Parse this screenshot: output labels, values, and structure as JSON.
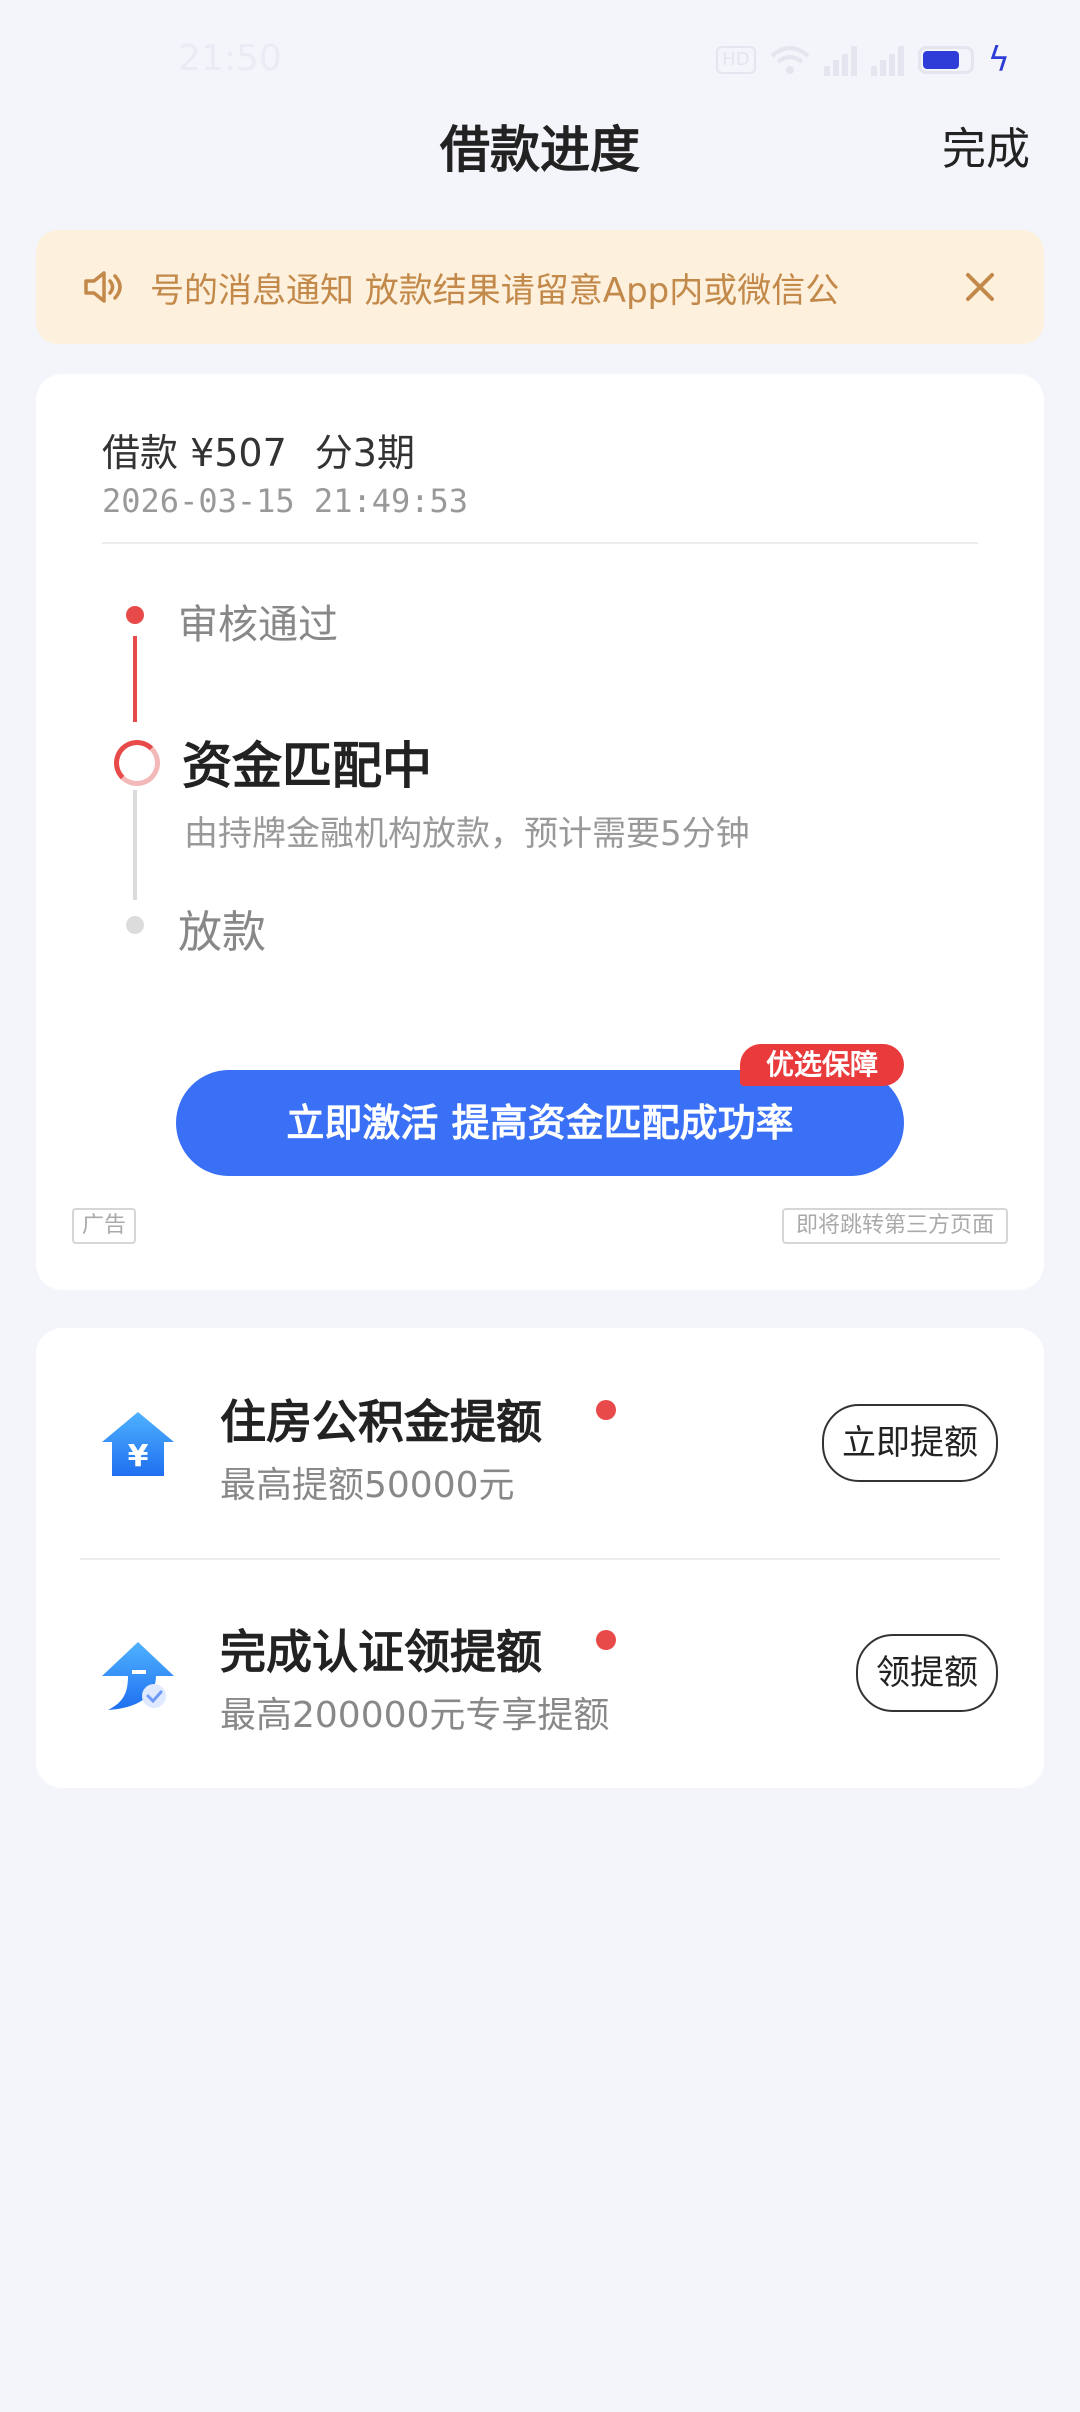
{
  "status_bar": {
    "time": "21:50",
    "network_badge": "HD",
    "wifi_icon": "wifi-icon",
    "signal_icon": "signal-icon",
    "battery_icon": "battery-icon",
    "charging_icon": "charging-bolt-icon"
  },
  "header": {
    "title": "借款进度",
    "done_label": "完成"
  },
  "notice": {
    "icon": "speaker-icon",
    "text": "号的消息通知 放款结果请留意App内或微信公",
    "close_icon": "close-icon",
    "color": "#c2894a"
  },
  "loan": {
    "amount": "借款 ¥507",
    "periods": "分3期",
    "time": "2026-03-15 21:49:53"
  },
  "progress": {
    "steps": [
      {
        "label": "审核通过",
        "status": "done"
      },
      {
        "label": "资金匹配中",
        "status": "current",
        "desc": "由持牌金融机构放款，预计需要5分钟"
      },
      {
        "label": "放款",
        "status": "pending"
      }
    ],
    "accent_color": "#e84a4a"
  },
  "cta": {
    "label": "立即激活 提高资金匹配成功率",
    "badge": "优选保障",
    "color": "#3a70f6"
  },
  "ad": {
    "tag": "广告",
    "jump_note": "即将跳转第三方页面"
  },
  "offers": [
    {
      "icon": "house-yen-icon",
      "title": "住房公积金提额",
      "subtitle": "最高提额50000元",
      "button": "立即提额"
    },
    {
      "icon": "arrow-up-verified-icon",
      "title": "完成认证领提额",
      "subtitle": "最高200000元专享提额",
      "button": "领提额"
    }
  ]
}
